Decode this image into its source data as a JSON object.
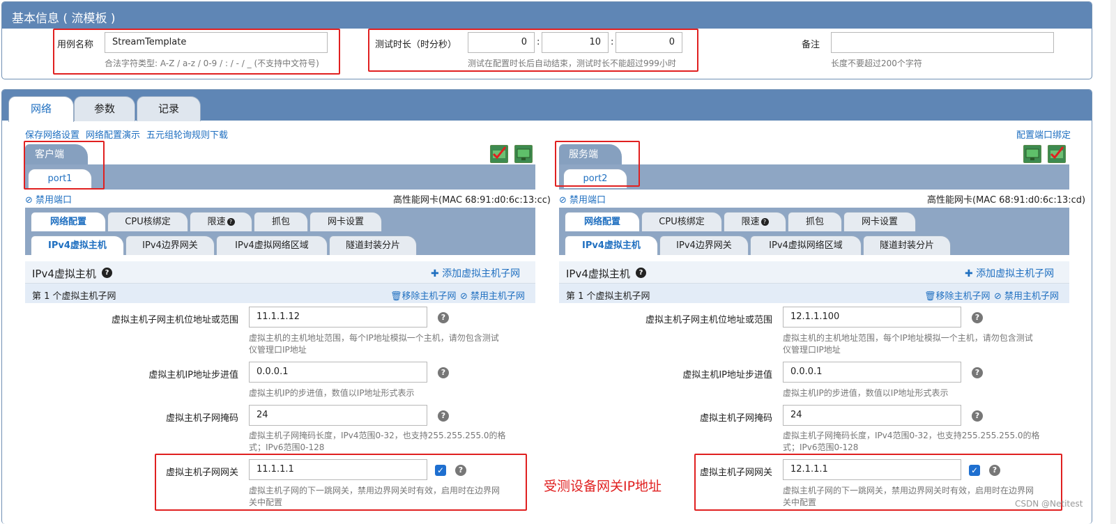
{
  "header": {
    "title": "基本信息 ( 流模板 )"
  },
  "basic": {
    "case_name_label": "用例名称",
    "case_name_value": "StreamTemplate",
    "case_name_hint": "合法字符类型: A-Z / a-z / 0-9 / : / - / _ (不支持中文符号)",
    "duration_label": "测试时长（时分秒）",
    "hours": "0",
    "minutes": "10",
    "seconds": "0",
    "sep": ":",
    "duration_hint": "测试在配置时长后自动结束，测试时长不能超过999小时",
    "note_label": "备注",
    "note_value": "",
    "note_hint": "长度不要超过200个字符"
  },
  "tabs": [
    "网络",
    "参数",
    "记录"
  ],
  "links": {
    "save": "保存网络设置",
    "demo": "网络配置演示",
    "download": "五元组轮询规则下载",
    "bind": "配置端口绑定"
  },
  "client": {
    "title": "客户端",
    "port": "port1",
    "disable": "禁用端口",
    "nic": "高性能网卡(MAC 68:91:d0:6c:13:cc)"
  },
  "server": {
    "title": "服务端",
    "port": "port2",
    "disable": "禁用端口",
    "nic": "高性能网卡(MAC 68:91:d0:6c:13:cd)"
  },
  "subtabs1": [
    "网络配置",
    "CPU核绑定",
    "限速",
    "抓包",
    "网卡设置"
  ],
  "subtabs2": [
    "IPv4虚拟主机",
    "IPv4边界网关",
    "IPv4虚拟网络区域",
    "隧道封装分片"
  ],
  "section": {
    "title": "IPv4虚拟主机",
    "add": "添加虚拟主机子网",
    "sub": "第 1 个虚拟主机子网",
    "remove": "移除主机子网",
    "disable": "禁用主机子网"
  },
  "fields": {
    "range_label": "虚拟主机子网主机位地址或范围",
    "range_hint1": "虚拟主机的主机地址范围，每个IP地址模拟一个主机，请勿包含测试",
    "range_hint2": "仪管理口IP地址",
    "step_label": "虚拟主机IP地址步进值",
    "step_hint": "虚拟主机IP的步进值，数值以IP地址形式表示",
    "mask_label": "虚拟主机子网掩码",
    "mask_hint1": "虚拟主机子网掩码长度，IPv4范围0-32，也支持255.255.255.0的格",
    "mask_hint2": "式；IPv6范围0-128",
    "gw_label": "虚拟主机子网网关",
    "gw_hint1": "虚拟主机子网的下一跳网关，禁用边界网关时有效，启用时在边界网",
    "gw_hint2": "关中配置"
  },
  "client_values": {
    "range": "11.1.1.12",
    "step": "0.0.0.1",
    "mask": "24",
    "gw": "11.1.1.1"
  },
  "server_values": {
    "range": "12.1.1.100",
    "step": "0.0.0.1",
    "mask": "24",
    "gw": "12.1.1.1"
  },
  "annotation": "受测设备网关IP地址",
  "watermark": "CSDN @Netitest"
}
